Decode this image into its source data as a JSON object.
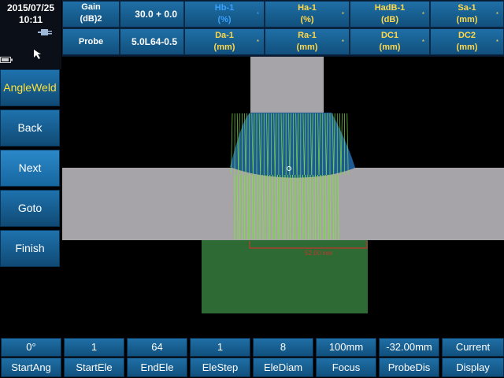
{
  "status": {
    "date": "2015/07/25",
    "time": "10:11"
  },
  "topbar": {
    "gain_label_1": "Gain",
    "gain_label_2": "(dB)2",
    "gain_value": "30.0 + 0.0",
    "probe_label": "Probe",
    "probe_value": "5.0L64-0.5",
    "measures": [
      {
        "label": "Hb-1",
        "unit": "(%)"
      },
      {
        "label": "Ha-1",
        "unit": "(%)"
      },
      {
        "label": "HadB-1",
        "unit": "(dB)"
      },
      {
        "label": "Sa-1",
        "unit": "(mm)"
      },
      {
        "label": "Da-1",
        "unit": "(mm)"
      },
      {
        "label": "Ra-1",
        "unit": "(mm)"
      },
      {
        "label": "DC1",
        "unit": "(mm)"
      },
      {
        "label": "DC2",
        "unit": "(mm)"
      }
    ],
    "star": "*"
  },
  "menu": {
    "title": "AngleWeld",
    "items": [
      "Back",
      "Next",
      "Goto",
      "Finish"
    ]
  },
  "canvas": {
    "overlay_text": "52.00 mm"
  },
  "params": [
    {
      "value": "0°",
      "label": "StartAng"
    },
    {
      "value": "1",
      "label": "StartEle"
    },
    {
      "value": "64",
      "label": "EndEle"
    },
    {
      "value": "1",
      "label": "EleStep"
    },
    {
      "value": "8",
      "label": "EleDiam"
    },
    {
      "value": "100mm",
      "label": "Focus"
    },
    {
      "value": "-32.00mm",
      "label": "ProbeDis"
    },
    {
      "value": "Current",
      "label": "Display"
    }
  ],
  "colors": {
    "plate": "#a6a4a8",
    "beam": "#7de040",
    "fan": "#1e5b95",
    "wedge": "#2e6a34",
    "marker": "#c0392b"
  }
}
